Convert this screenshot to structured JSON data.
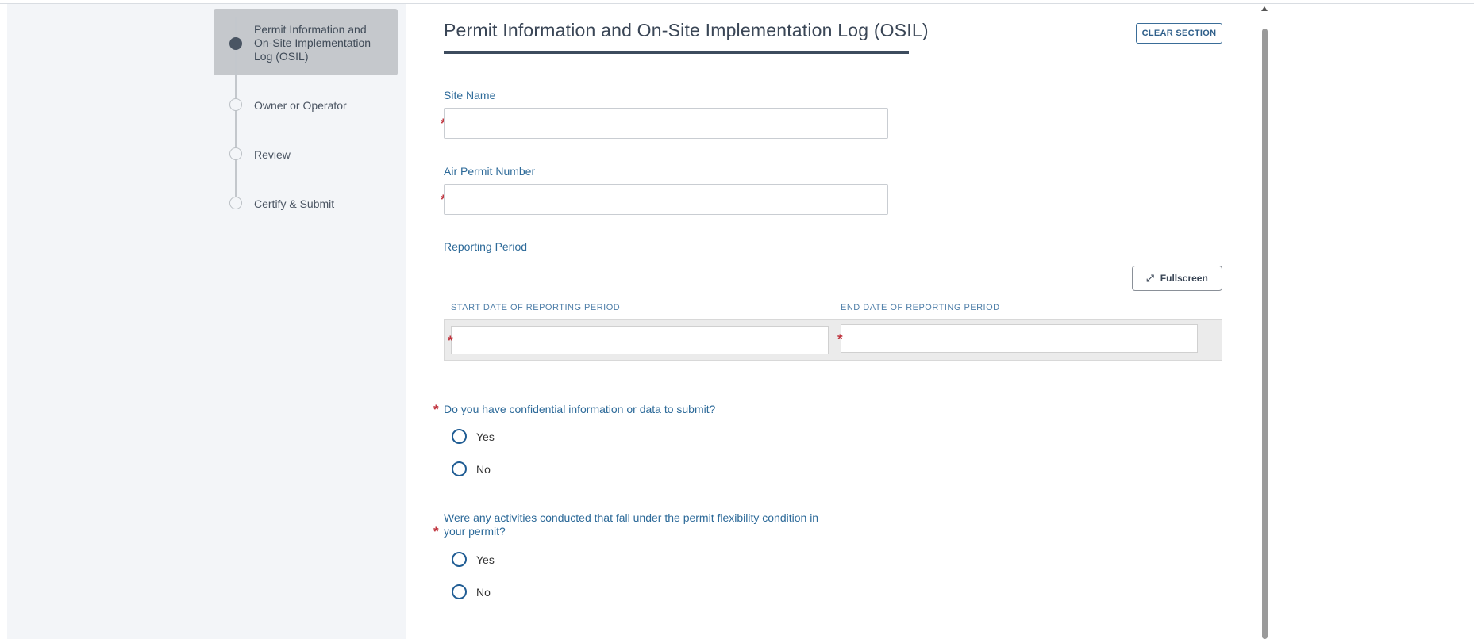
{
  "stepper": {
    "items": [
      {
        "label": "Permit Information and On-Site Implementation Log (OSIL)",
        "active": true
      },
      {
        "label": "Owner or Operator",
        "active": false
      },
      {
        "label": "Review",
        "active": false
      },
      {
        "label": "Certify & Submit",
        "active": false
      }
    ],
    "active_line1": "Permit Information and",
    "active_line2": "On-Site Implementation",
    "active_line3": "Log (OSIL)"
  },
  "section": {
    "title": "Permit Information and On-Site Implementation Log (OSIL)",
    "clear_label": "CLEAR SECTION"
  },
  "fields": {
    "site_name": {
      "label": "Site Name",
      "value": ""
    },
    "air_permit": {
      "label": "Air Permit Number",
      "value": ""
    },
    "reporting_period": {
      "label": "Reporting Period",
      "fullscreen_label": "Fullscreen",
      "columns": [
        "START DATE OF REPORTING PERIOD",
        "END DATE OF REPORTING PERIOD"
      ]
    }
  },
  "questions": {
    "confidential": {
      "text": "Do you have confidential information or data to submit?",
      "options": [
        "Yes",
        "No"
      ]
    },
    "flexibility": {
      "line1": "Were any activities conducted that fall under the permit flexibility condition in",
      "line2": "your permit?",
      "options": [
        "Yes",
        "No"
      ]
    }
  },
  "required_mark": "*",
  "colors": {
    "accent": "#2d6a99",
    "required": "#c0353f",
    "title_rule": "#3d4c5e"
  }
}
